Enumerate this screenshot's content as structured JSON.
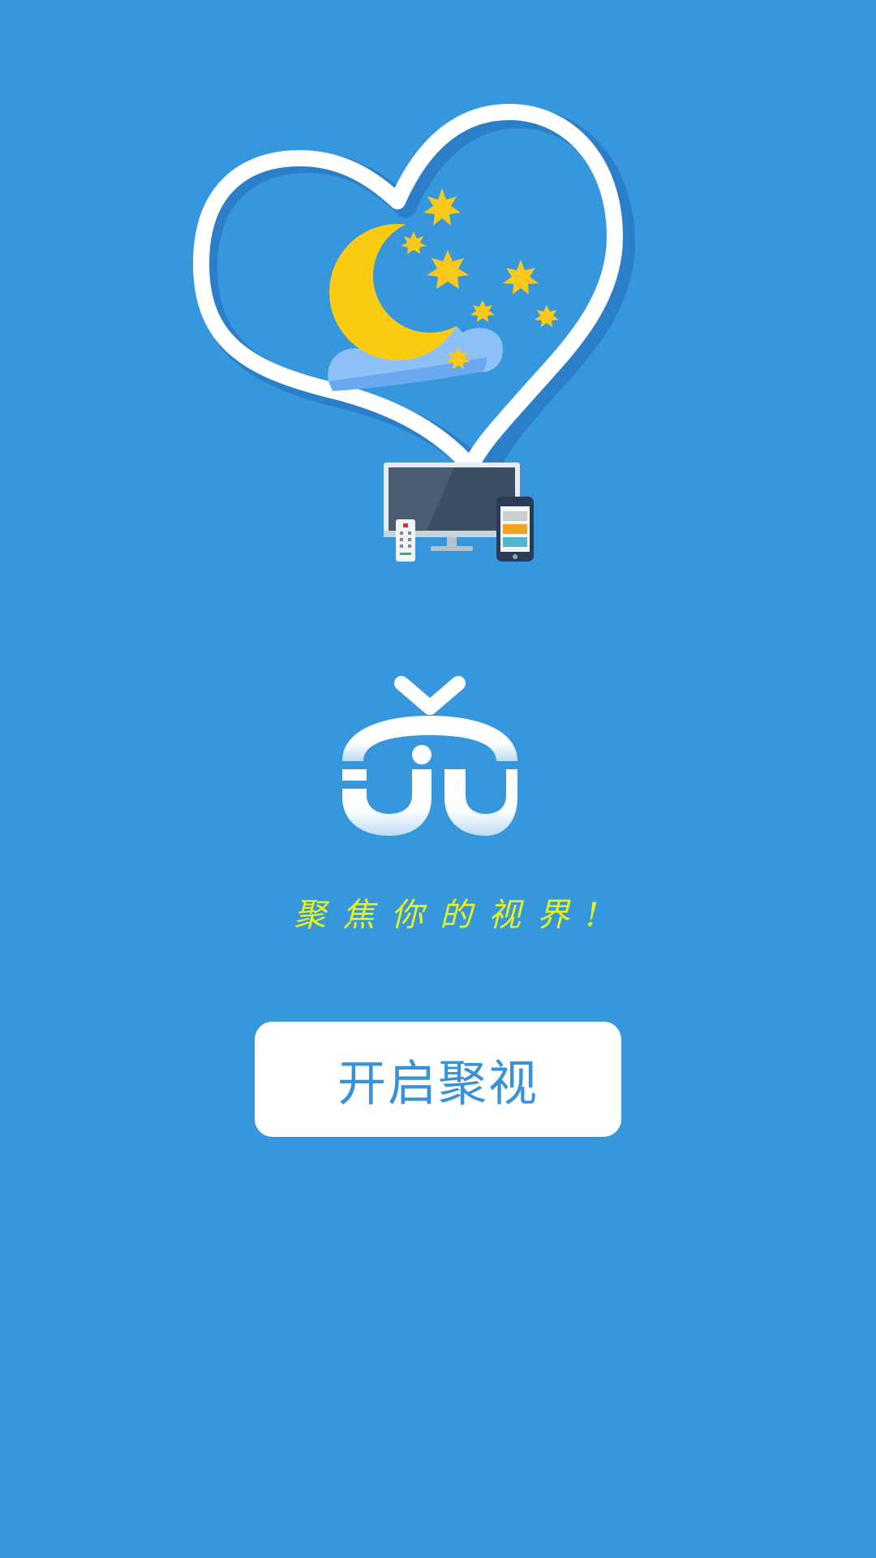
{
  "colors": {
    "background": "#3797dc",
    "heart_outline": "#ffffff",
    "moon": "#fccc12",
    "stars": "#f8c81b",
    "cloud": "#8ec1f7",
    "slogan": "#e8f21c",
    "button_bg": "#ffffff",
    "button_text": "#3a92d6"
  },
  "hero": {
    "icons": [
      "heart-outline-icon",
      "crescent-moon-icon",
      "star-icon",
      "cloud-icon",
      "tv-monitor-icon",
      "remote-control-icon",
      "smartphone-icon"
    ]
  },
  "logo": {
    "icon": "juju-tv-logo-icon"
  },
  "slogan": "聚焦你的视界!",
  "start_button": {
    "label": "开启聚视"
  }
}
